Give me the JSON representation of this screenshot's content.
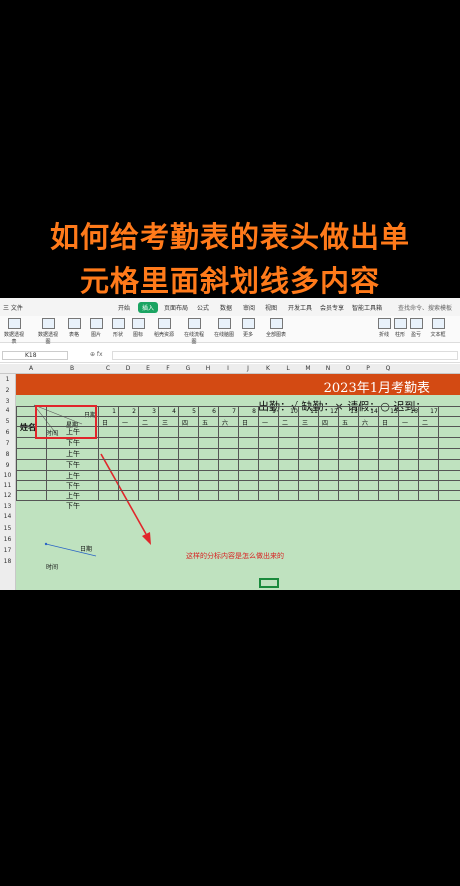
{
  "overlay_title": [
    "如何给考勤表的表头做出单",
    "元格里面斜划线多内容"
  ],
  "menu": {
    "file": "三 文件",
    "tabs": [
      "开始",
      "插入",
      "页面布局",
      "公式",
      "数据",
      "审阅",
      "视图",
      "开发工具",
      "会员专享",
      "智能工具箱"
    ],
    "active_tab": "插入",
    "search": "查找命令、搜索模板"
  },
  "ribbon": [
    "数据透视表",
    "数据透视图",
    "表格",
    "图片",
    "形状",
    "图标",
    "稻壳资源",
    "在线流程图",
    "在线脑图",
    "更多",
    "全部图表",
    "折线",
    "柱形",
    "盈亏",
    "文本框"
  ],
  "formula_bar": {
    "name_box": "K18",
    "icons": "⊕ fx"
  },
  "columns": [
    "A",
    "B",
    "C",
    "D",
    "E",
    "F",
    "G",
    "H",
    "I",
    "J",
    "K",
    "L",
    "M",
    "N",
    "O",
    "P",
    "Q"
  ],
  "rows": [
    "1",
    "2",
    "3",
    "4",
    "5",
    "6",
    "7",
    "8",
    "9",
    "10",
    "11",
    "12",
    "13",
    "14",
    "15",
    "16",
    "17",
    "18"
  ],
  "sheet": {
    "banner_title": "2023年1月考勤表",
    "legend": "出勤：√   缺勤：×  请假：○  迟到：",
    "name_header": "姓名",
    "diag_labels": {
      "top": "日期",
      "mid": "星期",
      "bottom": "时间"
    },
    "day_numbers": [
      "1",
      "2",
      "3",
      "4",
      "5",
      "6",
      "7",
      "8",
      "9",
      "10",
      "11",
      "12",
      "13",
      "14",
      "15",
      "16",
      "17"
    ],
    "weekdays": [
      "日",
      "一",
      "二",
      "三",
      "四",
      "五",
      "六",
      "日",
      "一",
      "二",
      "三",
      "四",
      "五",
      "六",
      "日",
      "一",
      "二"
    ],
    "b_cells": [
      "上午",
      "下午",
      "上午",
      "下午",
      "上午",
      "下午",
      "上午",
      "下午"
    ],
    "example_labels": {
      "top": "日期",
      "bottom": "时间"
    },
    "annotation": "这样的分标内容是怎么做出来的"
  },
  "colors": {
    "title": "#ff7a1a",
    "banner": "#d34a13",
    "sheet_bg": "#bfe2bf",
    "annotation": "#d82121",
    "active_tab": "#1ba462"
  }
}
